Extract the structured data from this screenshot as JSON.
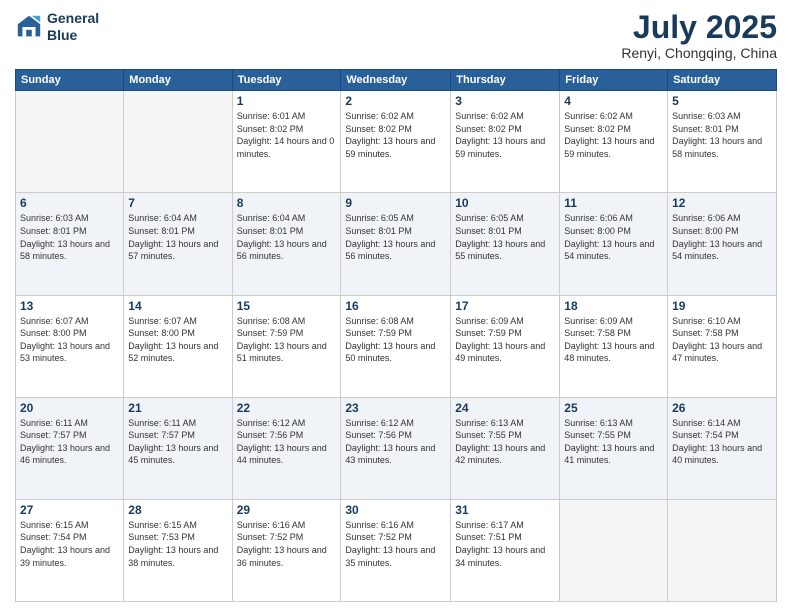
{
  "header": {
    "logo_line1": "General",
    "logo_line2": "Blue",
    "month": "July 2025",
    "location": "Renyi, Chongqing, China"
  },
  "weekdays": [
    "Sunday",
    "Monday",
    "Tuesday",
    "Wednesday",
    "Thursday",
    "Friday",
    "Saturday"
  ],
  "weeks": [
    [
      {
        "day": "",
        "sunrise": "",
        "sunset": "",
        "daylight": ""
      },
      {
        "day": "",
        "sunrise": "",
        "sunset": "",
        "daylight": ""
      },
      {
        "day": "1",
        "sunrise": "Sunrise: 6:01 AM",
        "sunset": "Sunset: 8:02 PM",
        "daylight": "Daylight: 14 hours and 0 minutes."
      },
      {
        "day": "2",
        "sunrise": "Sunrise: 6:02 AM",
        "sunset": "Sunset: 8:02 PM",
        "daylight": "Daylight: 13 hours and 59 minutes."
      },
      {
        "day": "3",
        "sunrise": "Sunrise: 6:02 AM",
        "sunset": "Sunset: 8:02 PM",
        "daylight": "Daylight: 13 hours and 59 minutes."
      },
      {
        "day": "4",
        "sunrise": "Sunrise: 6:02 AM",
        "sunset": "Sunset: 8:02 PM",
        "daylight": "Daylight: 13 hours and 59 minutes."
      },
      {
        "day": "5",
        "sunrise": "Sunrise: 6:03 AM",
        "sunset": "Sunset: 8:01 PM",
        "daylight": "Daylight: 13 hours and 58 minutes."
      }
    ],
    [
      {
        "day": "6",
        "sunrise": "Sunrise: 6:03 AM",
        "sunset": "Sunset: 8:01 PM",
        "daylight": "Daylight: 13 hours and 58 minutes."
      },
      {
        "day": "7",
        "sunrise": "Sunrise: 6:04 AM",
        "sunset": "Sunset: 8:01 PM",
        "daylight": "Daylight: 13 hours and 57 minutes."
      },
      {
        "day": "8",
        "sunrise": "Sunrise: 6:04 AM",
        "sunset": "Sunset: 8:01 PM",
        "daylight": "Daylight: 13 hours and 56 minutes."
      },
      {
        "day": "9",
        "sunrise": "Sunrise: 6:05 AM",
        "sunset": "Sunset: 8:01 PM",
        "daylight": "Daylight: 13 hours and 56 minutes."
      },
      {
        "day": "10",
        "sunrise": "Sunrise: 6:05 AM",
        "sunset": "Sunset: 8:01 PM",
        "daylight": "Daylight: 13 hours and 55 minutes."
      },
      {
        "day": "11",
        "sunrise": "Sunrise: 6:06 AM",
        "sunset": "Sunset: 8:00 PM",
        "daylight": "Daylight: 13 hours and 54 minutes."
      },
      {
        "day": "12",
        "sunrise": "Sunrise: 6:06 AM",
        "sunset": "Sunset: 8:00 PM",
        "daylight": "Daylight: 13 hours and 54 minutes."
      }
    ],
    [
      {
        "day": "13",
        "sunrise": "Sunrise: 6:07 AM",
        "sunset": "Sunset: 8:00 PM",
        "daylight": "Daylight: 13 hours and 53 minutes."
      },
      {
        "day": "14",
        "sunrise": "Sunrise: 6:07 AM",
        "sunset": "Sunset: 8:00 PM",
        "daylight": "Daylight: 13 hours and 52 minutes."
      },
      {
        "day": "15",
        "sunrise": "Sunrise: 6:08 AM",
        "sunset": "Sunset: 7:59 PM",
        "daylight": "Daylight: 13 hours and 51 minutes."
      },
      {
        "day": "16",
        "sunrise": "Sunrise: 6:08 AM",
        "sunset": "Sunset: 7:59 PM",
        "daylight": "Daylight: 13 hours and 50 minutes."
      },
      {
        "day": "17",
        "sunrise": "Sunrise: 6:09 AM",
        "sunset": "Sunset: 7:59 PM",
        "daylight": "Daylight: 13 hours and 49 minutes."
      },
      {
        "day": "18",
        "sunrise": "Sunrise: 6:09 AM",
        "sunset": "Sunset: 7:58 PM",
        "daylight": "Daylight: 13 hours and 48 minutes."
      },
      {
        "day": "19",
        "sunrise": "Sunrise: 6:10 AM",
        "sunset": "Sunset: 7:58 PM",
        "daylight": "Daylight: 13 hours and 47 minutes."
      }
    ],
    [
      {
        "day": "20",
        "sunrise": "Sunrise: 6:11 AM",
        "sunset": "Sunset: 7:57 PM",
        "daylight": "Daylight: 13 hours and 46 minutes."
      },
      {
        "day": "21",
        "sunrise": "Sunrise: 6:11 AM",
        "sunset": "Sunset: 7:57 PM",
        "daylight": "Daylight: 13 hours and 45 minutes."
      },
      {
        "day": "22",
        "sunrise": "Sunrise: 6:12 AM",
        "sunset": "Sunset: 7:56 PM",
        "daylight": "Daylight: 13 hours and 44 minutes."
      },
      {
        "day": "23",
        "sunrise": "Sunrise: 6:12 AM",
        "sunset": "Sunset: 7:56 PM",
        "daylight": "Daylight: 13 hours and 43 minutes."
      },
      {
        "day": "24",
        "sunrise": "Sunrise: 6:13 AM",
        "sunset": "Sunset: 7:55 PM",
        "daylight": "Daylight: 13 hours and 42 minutes."
      },
      {
        "day": "25",
        "sunrise": "Sunrise: 6:13 AM",
        "sunset": "Sunset: 7:55 PM",
        "daylight": "Daylight: 13 hours and 41 minutes."
      },
      {
        "day": "26",
        "sunrise": "Sunrise: 6:14 AM",
        "sunset": "Sunset: 7:54 PM",
        "daylight": "Daylight: 13 hours and 40 minutes."
      }
    ],
    [
      {
        "day": "27",
        "sunrise": "Sunrise: 6:15 AM",
        "sunset": "Sunset: 7:54 PM",
        "daylight": "Daylight: 13 hours and 39 minutes."
      },
      {
        "day": "28",
        "sunrise": "Sunrise: 6:15 AM",
        "sunset": "Sunset: 7:53 PM",
        "daylight": "Daylight: 13 hours and 38 minutes."
      },
      {
        "day": "29",
        "sunrise": "Sunrise: 6:16 AM",
        "sunset": "Sunset: 7:52 PM",
        "daylight": "Daylight: 13 hours and 36 minutes."
      },
      {
        "day": "30",
        "sunrise": "Sunrise: 6:16 AM",
        "sunset": "Sunset: 7:52 PM",
        "daylight": "Daylight: 13 hours and 35 minutes."
      },
      {
        "day": "31",
        "sunrise": "Sunrise: 6:17 AM",
        "sunset": "Sunset: 7:51 PM",
        "daylight": "Daylight: 13 hours and 34 minutes."
      },
      {
        "day": "",
        "sunrise": "",
        "sunset": "",
        "daylight": ""
      },
      {
        "day": "",
        "sunrise": "",
        "sunset": "",
        "daylight": ""
      }
    ]
  ]
}
